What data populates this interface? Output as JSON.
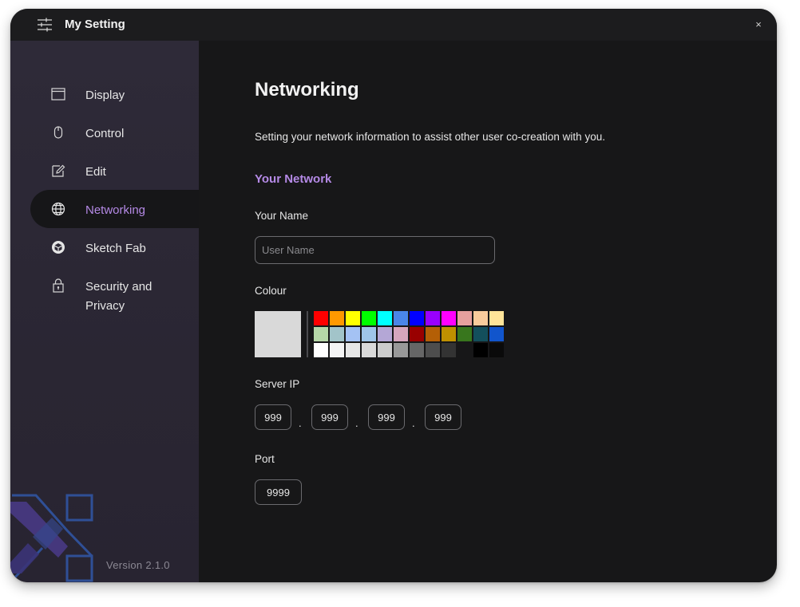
{
  "window": {
    "title": "My Setting",
    "close_label": "×"
  },
  "sidebar": {
    "items": [
      {
        "label": "Display",
        "icon": "window-icon"
      },
      {
        "label": "Control",
        "icon": "mouse-icon"
      },
      {
        "label": "Edit",
        "icon": "edit-icon"
      },
      {
        "label": "Networking",
        "icon": "globe-icon",
        "active": true
      },
      {
        "label": "Sketch Fab",
        "icon": "sketchfab-icon"
      },
      {
        "label": "Security and Privacy",
        "icon": "lock-icon"
      }
    ],
    "version": "Version 2.1.0"
  },
  "main": {
    "heading": "Networking",
    "description": "Setting your network information to assist other user co-creation with you.",
    "section_title": "Your Network",
    "name": {
      "label": "Your Name",
      "value": "",
      "placeholder": "User Name"
    },
    "colour": {
      "label": "Colour",
      "selected": "#d9d9d9",
      "palette": [
        "#ff0000",
        "#ff9900",
        "#ffff00",
        "#00ff00",
        "#00ffff",
        "#4a86e8",
        "#0000ff",
        "#9900ff",
        "#ff00ff",
        "#e6a09e",
        "#f9cb9c",
        "#ffe599",
        "#b6d7a8",
        "#a2c4c9",
        "#a4c2f4",
        "#9fc5e8",
        "#b4a7d6",
        "#d5a6bd",
        "#990000",
        "#b45f06",
        "#bf9000",
        "#38761d",
        "#134f5c",
        "#1155cc",
        "#ffffff",
        "#f3f3f3",
        "#e6e6e6",
        "#d9d9d9",
        "#cccccc",
        "#999999",
        "#666666",
        "#4d4d4d",
        "#333333",
        "#171718",
        "#000000",
        "#0a0a0a"
      ]
    },
    "server_ip": {
      "label": "Server IP",
      "octets": [
        "999",
        "999",
        "999",
        "999"
      ],
      "separator": "."
    },
    "port": {
      "label": "Port",
      "value": "9999"
    }
  }
}
